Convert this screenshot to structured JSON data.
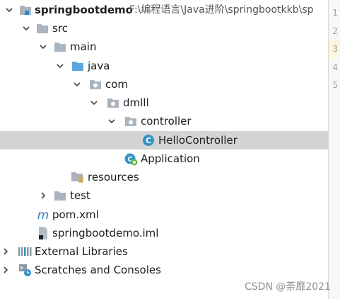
{
  "tree": [
    {
      "name": "project-node-springbootdemo",
      "arrow": "open",
      "icon": "folder-icon",
      "label": "springbootdemo",
      "path": "F:\\编程语言\\Java进阶\\springbootkkb\\sp",
      "bold": true
    },
    {
      "name": "folder-node-src",
      "arrow": "open",
      "icon": "folder-icon",
      "label": "src"
    },
    {
      "name": "folder-node-main",
      "arrow": "open",
      "icon": "folder-icon",
      "label": "main"
    },
    {
      "name": "folder-node-java",
      "arrow": "open",
      "icon": "source-folder-icon",
      "label": "java"
    },
    {
      "name": "package-node-com",
      "arrow": "open",
      "icon": "package-icon",
      "label": "com"
    },
    {
      "name": "package-node-dmlll",
      "arrow": "open",
      "icon": "package-icon",
      "label": "dmlll"
    },
    {
      "name": "package-node-controller",
      "arrow": "open",
      "icon": "package-icon",
      "label": "controller"
    },
    {
      "name": "class-node-hellocontroller",
      "arrow": "none",
      "icon": "java-class-icon",
      "label": "HelloController",
      "selected": true
    },
    {
      "name": "class-node-application",
      "arrow": "none",
      "icon": "spring-boot-app-icon",
      "label": "Application"
    },
    {
      "name": "folder-node-resources",
      "arrow": "none",
      "icon": "resources-folder-icon",
      "label": "resources"
    },
    {
      "name": "folder-node-test",
      "arrow": "closed",
      "icon": "folder-icon",
      "label": "test"
    },
    {
      "name": "file-node-pom-xml",
      "arrow": "none",
      "icon": "maven-icon",
      "label": "pom.xml"
    },
    {
      "name": "file-node-springbootdemo-iml",
      "arrow": "none",
      "icon": "iml-file-icon",
      "label": "springbootdemo.iml"
    },
    {
      "name": "node-external-libraries",
      "arrow": "closed",
      "icon": "libraries-icon",
      "label": "External Libraries"
    },
    {
      "name": "node-scratches-and-consoles",
      "arrow": "closed",
      "icon": "scratches-icon",
      "label": "Scratches and Consoles"
    }
  ],
  "gutter": {
    "lines": [
      "1",
      "2",
      "3",
      "4",
      "5"
    ],
    "current": "3"
  },
  "watermark": "CSDN @荼靡2021",
  "colors": {
    "selection": "#d4d4d4",
    "folder": "#a9b4bf",
    "source_folder": "#5aa7db",
    "class": "#3592c4",
    "maven": "#3a7cc4"
  }
}
